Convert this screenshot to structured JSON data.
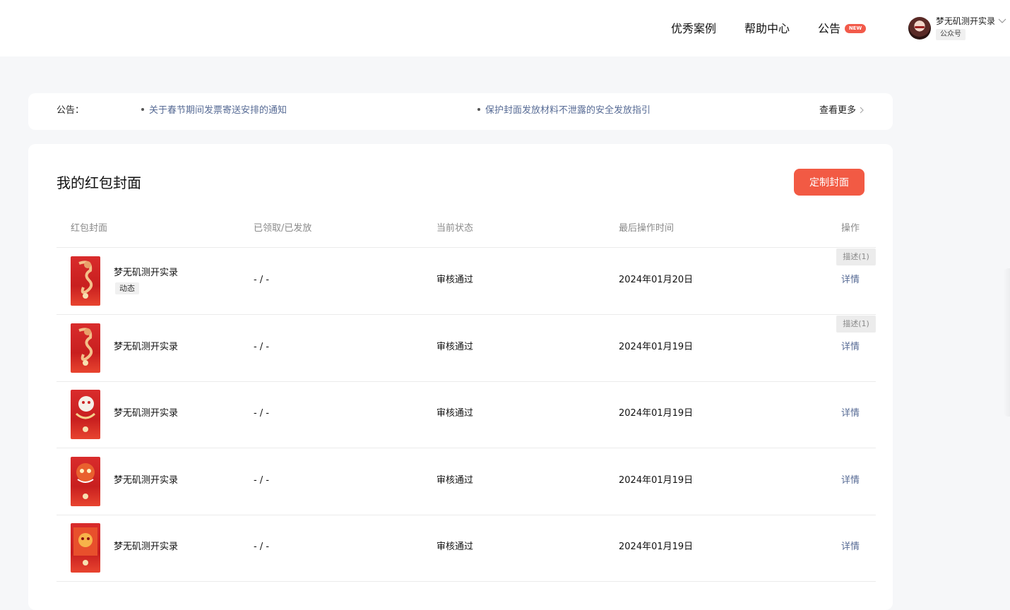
{
  "nav": {
    "items": [
      {
        "label": "优秀案例"
      },
      {
        "label": "帮助中心"
      },
      {
        "label": "公告",
        "badge": "NEW"
      }
    ],
    "user": {
      "name": "梦无矶测开实录",
      "account_type": "公众号"
    }
  },
  "notice": {
    "label": "公告：",
    "links": [
      "关于春节期间发票寄送安排的通知",
      "保护封面发放材料不泄露的安全发放指引"
    ],
    "more": "查看更多"
  },
  "covers": {
    "title": "我的红包封面",
    "create_button": "定制封面",
    "columns": [
      "红包封面",
      "已领取/已发放",
      "当前状态",
      "最后操作时间",
      "操作"
    ],
    "rows": [
      {
        "name": "梦无矶测开实录",
        "tag": "动态",
        "claimed": "- / -",
        "status": "审核通过",
        "time": "2024年01月20日",
        "desc_badge": "描述(1)",
        "action": "详情"
      },
      {
        "name": "梦无矶测开实录",
        "claimed": "- / -",
        "status": "审核通过",
        "time": "2024年01月19日",
        "desc_badge": "描述(1)",
        "action": "详情"
      },
      {
        "name": "梦无矶测开实录",
        "claimed": "- / -",
        "status": "审核通过",
        "time": "2024年01月19日",
        "action": "详情"
      },
      {
        "name": "梦无矶测开实录",
        "claimed": "- / -",
        "status": "审核通过",
        "time": "2024年01月19日",
        "action": "详情"
      },
      {
        "name": "梦无矶测开实录",
        "claimed": "- / -",
        "status": "审核通过",
        "time": "2024年01月19日",
        "action": "详情"
      }
    ]
  },
  "colors": {
    "accent": "#f25a44",
    "link": "#576b95",
    "badge": "#f25a4a"
  }
}
